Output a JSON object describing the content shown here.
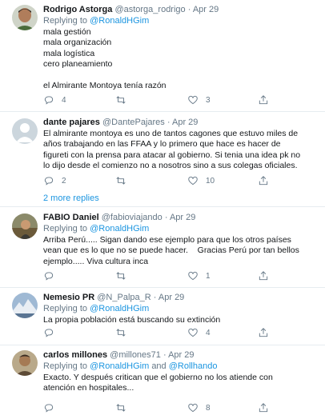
{
  "tweets": [
    {
      "name": "Rodrigo Astorga",
      "handle": "@astorga_rodrigo",
      "sep": "·",
      "date": "Apr 29",
      "replying_prefix": "Replying to",
      "mention1": "@RonaldHGim",
      "lines": [
        "mala gestión",
        "mala organización",
        "mala logística",
        "cero planeamiento",
        "",
        "el Almirante Montoya tenía razón"
      ],
      "replies": "4",
      "retweets": "",
      "likes": "3"
    },
    {
      "name": "dante pajares",
      "handle": "@DantePajares",
      "sep": "·",
      "date": "Apr 29",
      "lines": [
        "El almirante montoya es uno de tantos cagones que estuvo miles de",
        "años trabajando en las FFAA y lo primero que hace es hacer de",
        "figureti con la prensa para atacar al gobierno. Si tenia una idea pk no",
        "lo dijo desde el comienzo no a nosotros sino a sus colegas oficiales."
      ],
      "replies": "2",
      "retweets": "",
      "likes": "10",
      "more_replies": "2 more replies"
    },
    {
      "name": "FABIO Daniel",
      "handle": "@fabioviajando",
      "sep": "·",
      "date": "Apr 29",
      "replying_prefix": "Replying to",
      "mention1": "@RonaldHGim",
      "lines": [
        "Arriba Perú..... Sigan dando ese ejemplo para que los otros países",
        "vean que es lo que no se puede hacer.    Gracias Perú por tan bellos",
        "ejemplo..... Viva cultura inca"
      ],
      "replies": "",
      "retweets": "",
      "likes": "1"
    },
    {
      "name": "Nemesio PR",
      "handle": "@N_Palpa_R",
      "sep": "·",
      "date": "Apr 29",
      "replying_prefix": "Replying to",
      "mention1": "@RonaldHGim",
      "lines": [
        "La propia población está buscando su extinción"
      ],
      "replies": "",
      "retweets": "",
      "likes": "4"
    },
    {
      "name": "carlos millones",
      "handle": "@millones71",
      "sep": "·",
      "date": "Apr 29",
      "replying_prefix": "Replying to",
      "mention1": "@RonaldHGim",
      "and": "and",
      "mention2": "@Rollhando",
      "lines": [
        "Exacto. Y después critican que el gobierno no los atiende con",
        "atención en hospitales..."
      ],
      "replies": "",
      "retweets": "",
      "likes": "8"
    }
  ],
  "icons": {
    "reply": "reply-icon",
    "retweet": "retweet-icon",
    "like": "heart-icon",
    "share": "share-icon"
  },
  "colors": {
    "link": "#1b95e0",
    "muted": "#657786",
    "border": "#e6ecf0",
    "text": "#14171a"
  }
}
